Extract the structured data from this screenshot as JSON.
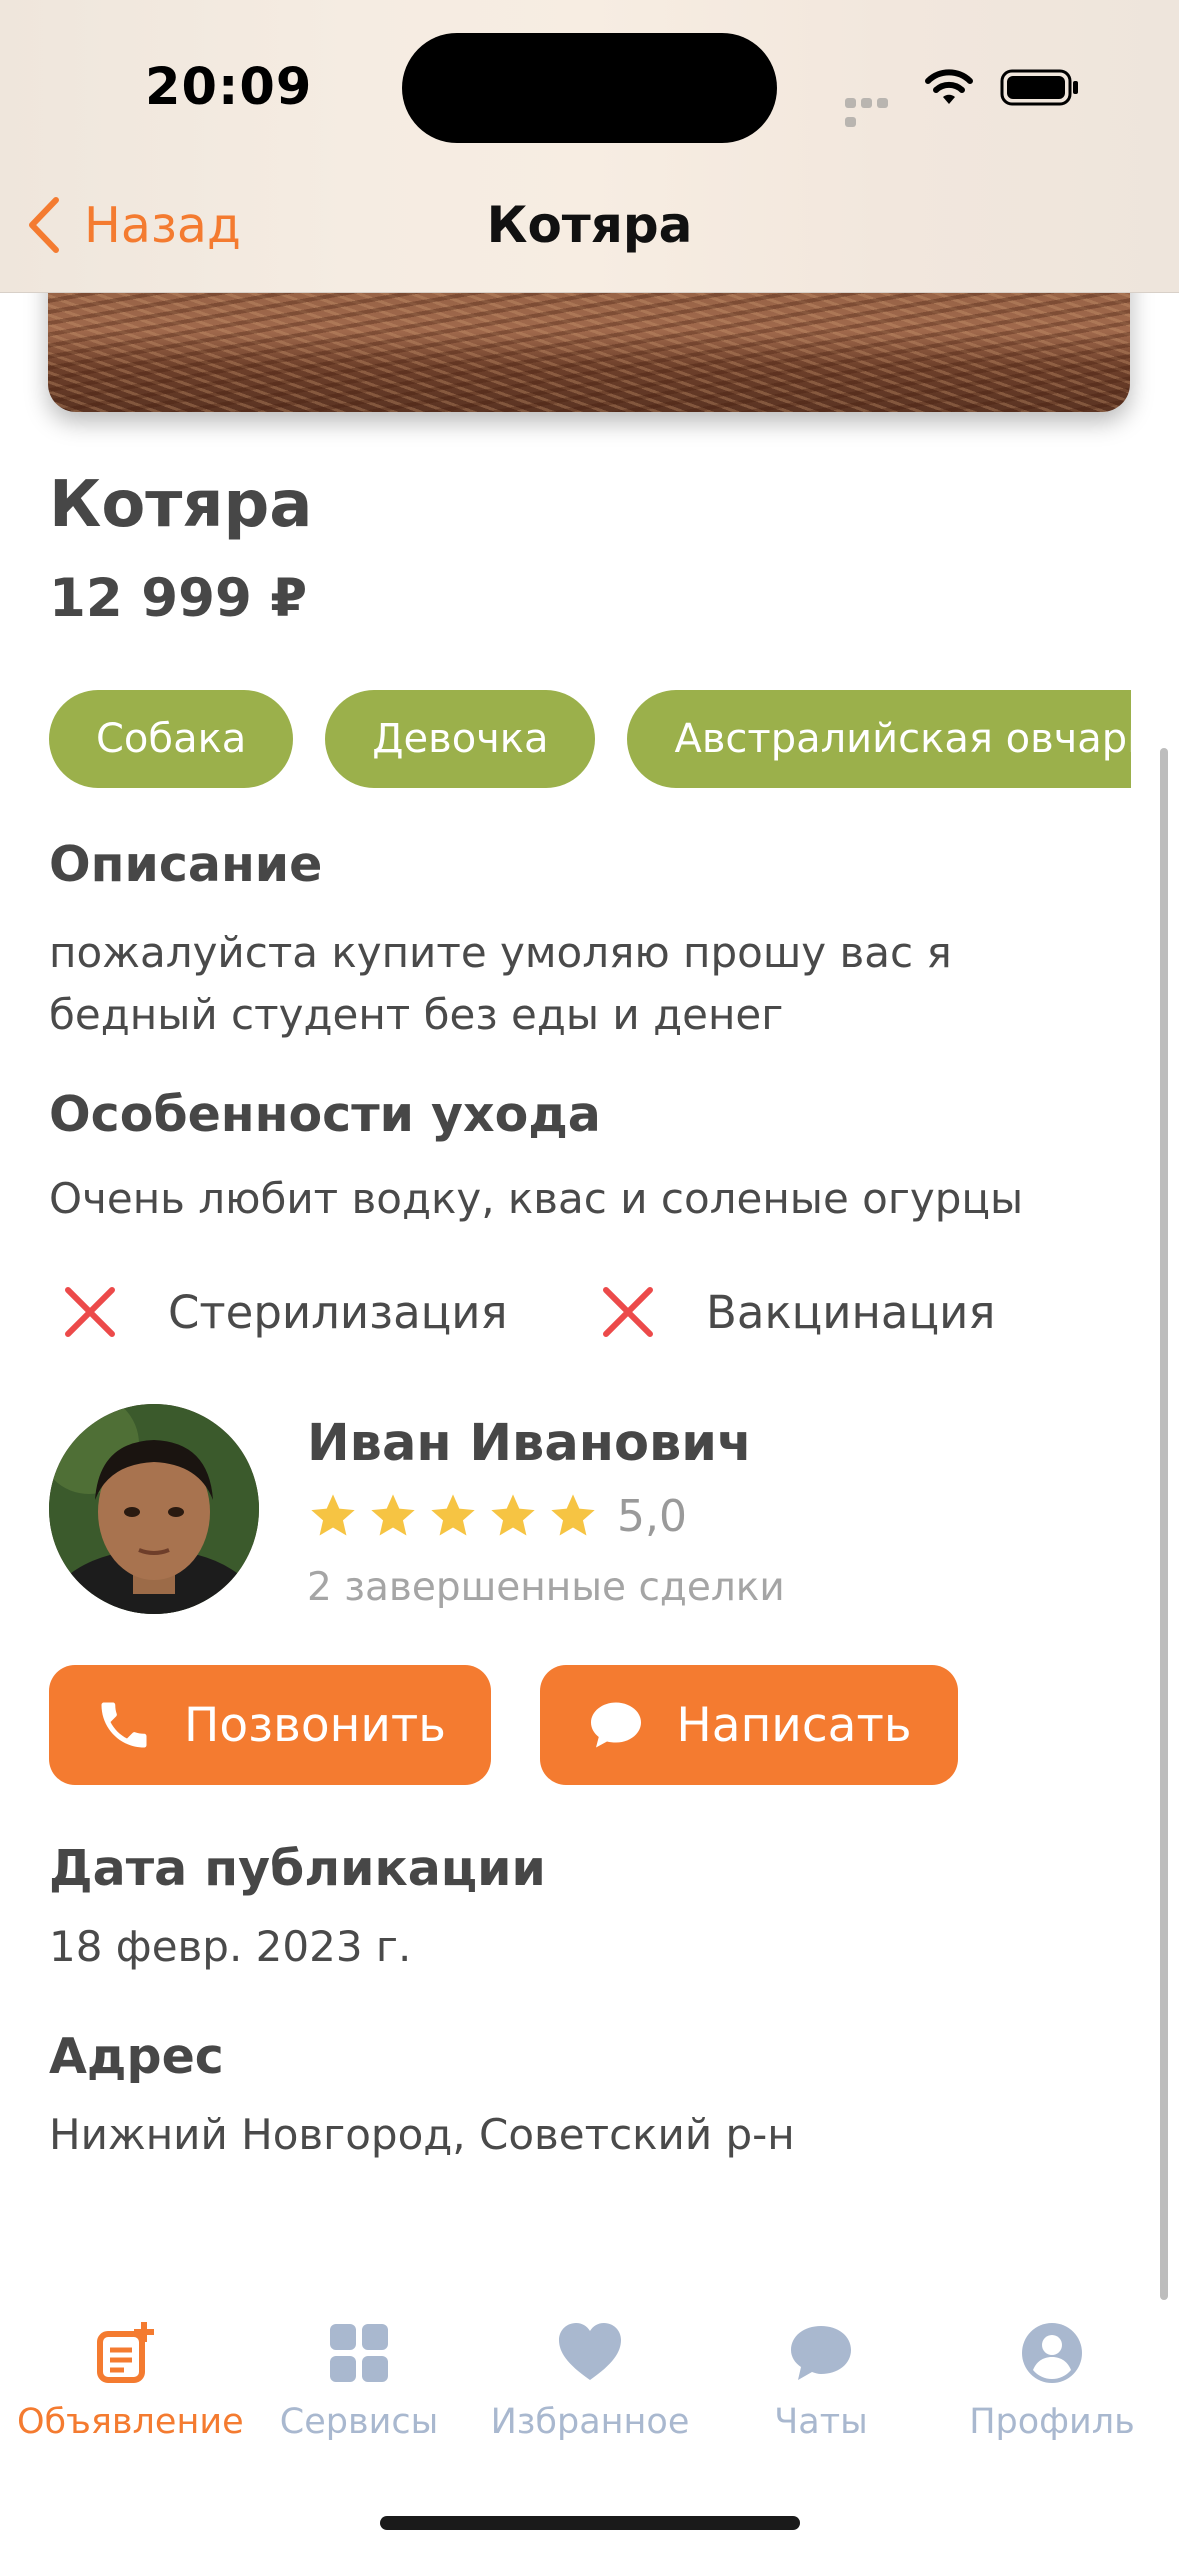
{
  "status_bar": {
    "time": "20:09"
  },
  "nav": {
    "back_label": "Назад",
    "title": "Котяра"
  },
  "listing": {
    "title": "Котяра",
    "price": "12 999 ₽",
    "tags": [
      "Собака",
      "Девочка",
      "Австралийская овчарка"
    ]
  },
  "description": {
    "heading": "Описание",
    "text": "пожалуйста купите умоляю прошу вас я бедный студент без еды и денег"
  },
  "care": {
    "heading": "Особенности ухода",
    "text": "Очень любит водку, квас и соленые огурцы"
  },
  "health": {
    "sterilization": {
      "label": "Стерилизация",
      "status": "no"
    },
    "vaccination": {
      "label": "Вакцинация",
      "status": "no"
    }
  },
  "seller": {
    "name": "Иван Иванович",
    "rating": "5,0",
    "stars": 5,
    "deals": "2 завершенные сделки"
  },
  "actions": {
    "call": "Позвонить",
    "message": "Написать"
  },
  "published": {
    "heading": "Дата публикации",
    "value": "18 февр. 2023 г."
  },
  "address": {
    "heading": "Адрес",
    "value": "Нижний Новгород, Советский р-н"
  },
  "tabbar": {
    "items": [
      {
        "label": "Объявление",
        "icon": "ad-add-icon",
        "active": true
      },
      {
        "label": "Сервисы",
        "icon": "grid-icon",
        "active": false
      },
      {
        "label": "Избранное",
        "icon": "heart-icon",
        "active": false
      },
      {
        "label": "Чаты",
        "icon": "chat-bubble-icon",
        "active": false
      },
      {
        "label": "Профиль",
        "icon": "profile-icon",
        "active": false
      }
    ]
  },
  "colors": {
    "accent": "#f47b30",
    "tag": "#9bb04b",
    "star": "#f6c443",
    "cross": "#ec4a4a",
    "tab_inactive": "#a9b8cf"
  }
}
